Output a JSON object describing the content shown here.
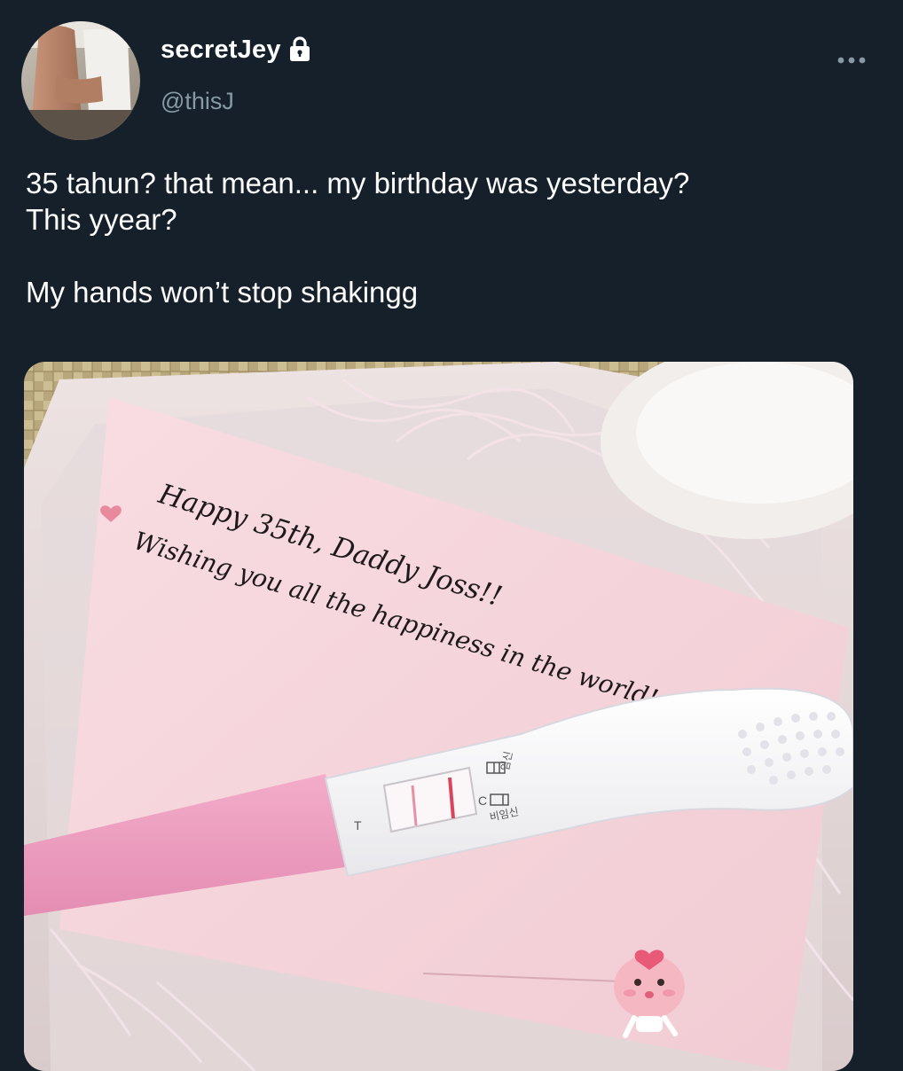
{
  "tweet": {
    "author": {
      "display_name": "secretJey",
      "handle": "@thisJ",
      "protected_icon": "lock-icon",
      "avatar_icon": "avatar"
    },
    "more_icon": "more-horizontal-icon",
    "text_line1": "35 tahun? that mean... my birthday was yesterday?\nThis yyear?",
    "text_line2": "My hands won’t stop shakingg"
  },
  "media": {
    "card_line1": "Happy 35th, Daddy Joss!!",
    "card_line2": "Wishing you all the happiness in the world!",
    "test_label_t": "T",
    "test_label_c": "C",
    "test_result_pregnant": "임신",
    "test_result_not_pregnant": "비임신"
  },
  "colors": {
    "background": "#15202b",
    "secondary_text": "#8899a6",
    "card_pink": "#f5d3da",
    "test_pink": "#ec9cbf"
  }
}
